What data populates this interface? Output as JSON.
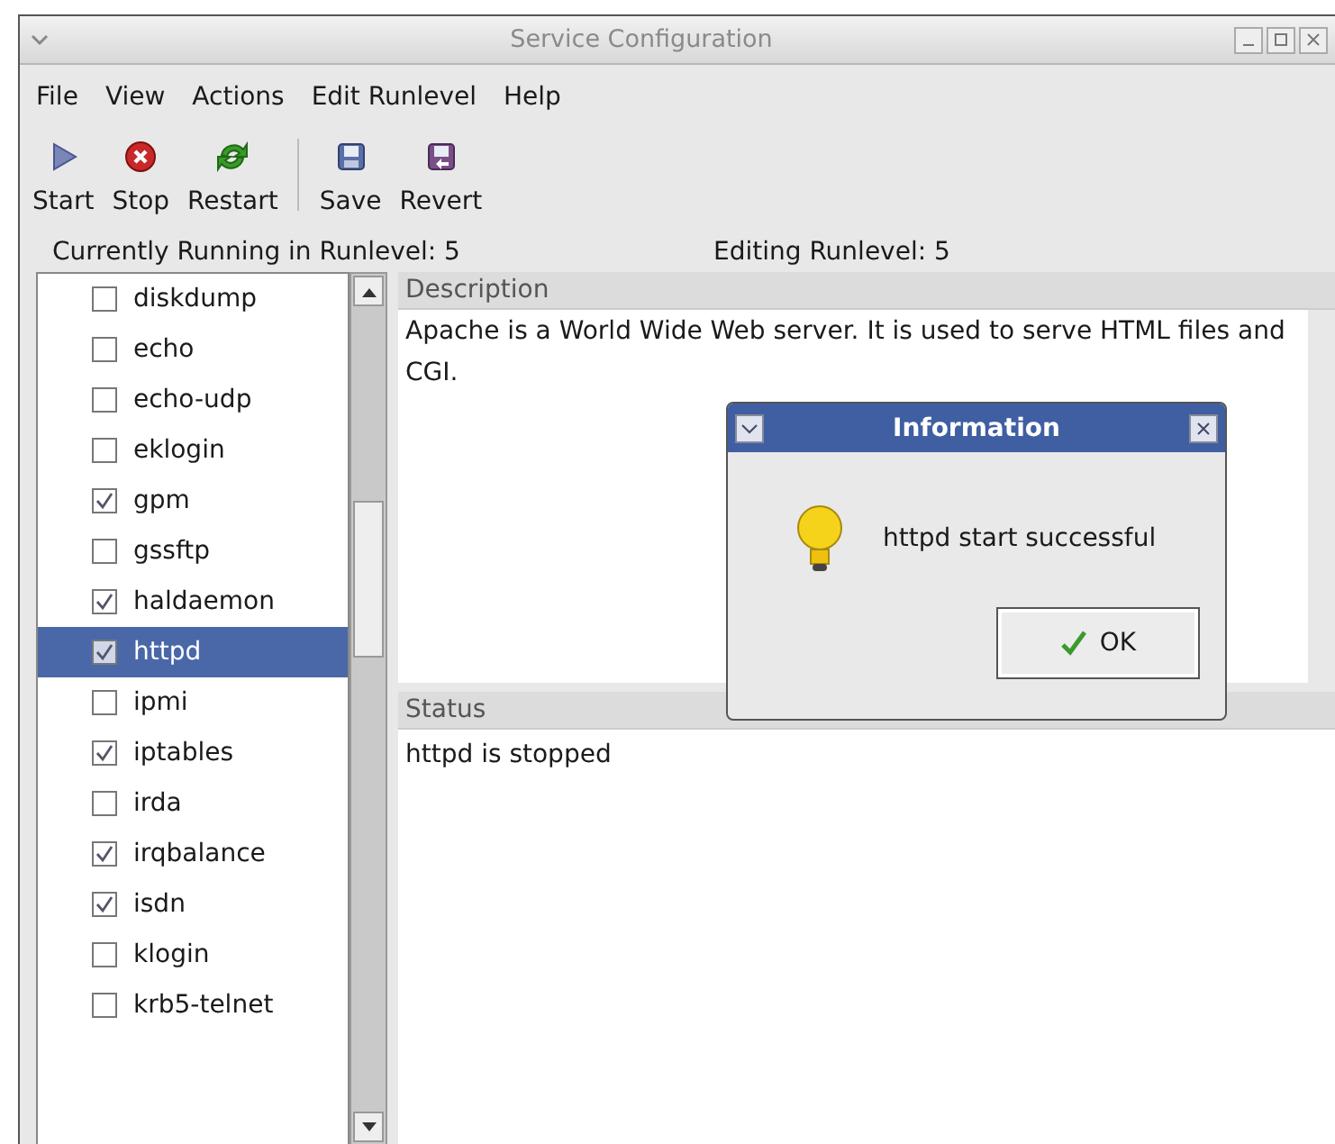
{
  "window": {
    "title": "Service Configuration"
  },
  "menu": [
    "File",
    "View",
    "Actions",
    "Edit Runlevel",
    "Help"
  ],
  "toolbar": [
    {
      "label": "Start",
      "kind": "start"
    },
    {
      "label": "Stop",
      "kind": "stop"
    },
    {
      "label": "Restart",
      "kind": "restart"
    },
    {
      "label": "Save",
      "kind": "save"
    },
    {
      "label": "Revert",
      "kind": "revert"
    }
  ],
  "runlevel": {
    "running": "Currently Running in Runlevel: 5",
    "editing": "Editing Runlevel: 5"
  },
  "services": [
    {
      "label": "diskdump",
      "checked": false,
      "selected": false
    },
    {
      "label": "echo",
      "checked": false,
      "selected": false
    },
    {
      "label": "echo-udp",
      "checked": false,
      "selected": false
    },
    {
      "label": "eklogin",
      "checked": false,
      "selected": false
    },
    {
      "label": "gpm",
      "checked": true,
      "selected": false
    },
    {
      "label": "gssftp",
      "checked": false,
      "selected": false
    },
    {
      "label": "haldaemon",
      "checked": true,
      "selected": false
    },
    {
      "label": "httpd",
      "checked": true,
      "selected": true
    },
    {
      "label": "ipmi",
      "checked": false,
      "selected": false
    },
    {
      "label": "iptables",
      "checked": true,
      "selected": false
    },
    {
      "label": "irda",
      "checked": false,
      "selected": false
    },
    {
      "label": "irqbalance",
      "checked": true,
      "selected": false
    },
    {
      "label": "isdn",
      "checked": true,
      "selected": false
    },
    {
      "label": "klogin",
      "checked": false,
      "selected": false
    },
    {
      "label": "krb5-telnet",
      "checked": false,
      "selected": false
    }
  ],
  "description": {
    "header": "Description",
    "text": "Apache is a World Wide Web server.  It is used to serve HTML files and CGI."
  },
  "status": {
    "header": "Status",
    "text": "httpd is stopped"
  },
  "dialog": {
    "title": "Information",
    "message": "httpd start successful",
    "button": "OK"
  }
}
